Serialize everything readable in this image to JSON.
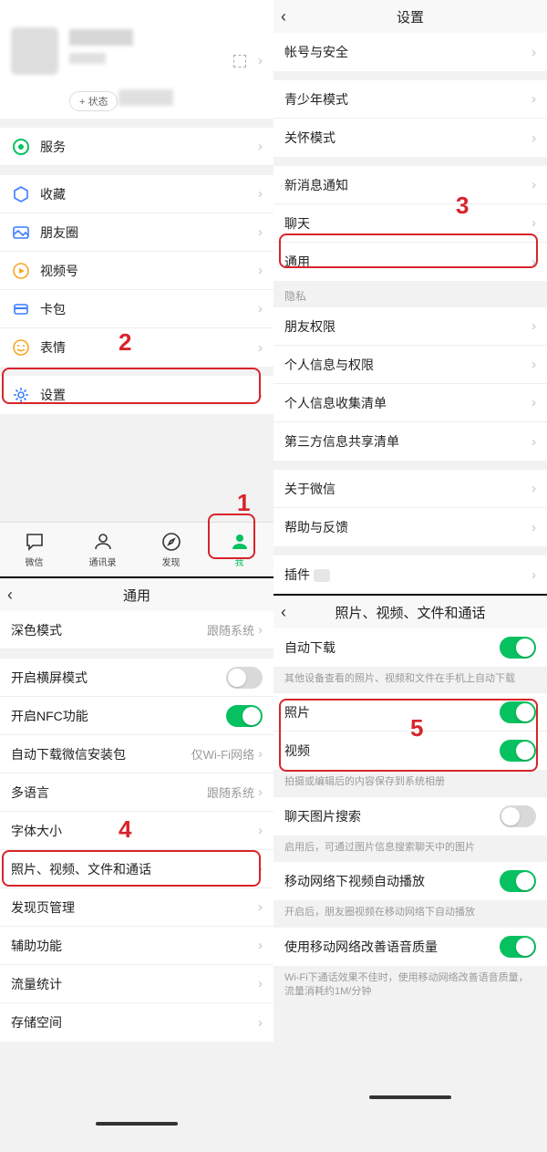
{
  "panel1": {
    "status_pill": "+ 状态",
    "items": {
      "services": "服务",
      "favorites": "收藏",
      "moments": "朋友圈",
      "channels": "视频号",
      "cards": "卡包",
      "stickers": "表情",
      "settings": "设置"
    },
    "tabs": {
      "chat": "微信",
      "contacts": "通讯录",
      "discover": "发现",
      "me": "我"
    }
  },
  "panel2": {
    "title": "设置",
    "items": {
      "account": "帐号与安全",
      "teen": "青少年模式",
      "care": "关怀模式",
      "notify": "新消息通知",
      "chat": "聊天",
      "general": "通用",
      "privacy_hdr": "隐私",
      "friends_perm": "朋友权限",
      "personal_info": "个人信息与权限",
      "info_collect": "个人信息收集清单",
      "thirdparty": "第三方信息共享清单",
      "about": "关于微信",
      "help": "帮助与反馈",
      "plugins": "插件"
    }
  },
  "panel3": {
    "title": "通用",
    "items": {
      "dark": "深色模式",
      "dark_val": "跟随系统",
      "landscape": "开启横屏模式",
      "nfc": "开启NFC功能",
      "autodl": "自动下载微信安装包",
      "autodl_val": "仅Wi-Fi网络",
      "lang": "多语言",
      "lang_val": "跟随系统",
      "font": "字体大小",
      "media": "照片、视频、文件和通话",
      "discover_mgmt": "发现页管理",
      "assist": "辅助功能",
      "traffic": "流量统计",
      "storage": "存储空间"
    }
  },
  "panel4": {
    "title": "照片、视频、文件和通话",
    "items": {
      "autodl": "自动下载",
      "autodl_note": "其他设备查看的照片、视频和文件在手机上自动下载",
      "photo": "照片",
      "video": "视频",
      "save_note": "拍摄或编辑后的内容保存到系统相册",
      "imgsearch": "聊天图片搜索",
      "imgsearch_note": "启用后，可通过图片信息搜索聊天中的图片",
      "mobileplay": "移动网络下视频自动播放",
      "mobileplay_note": "开启后，朋友圈视频在移动网络下自动播放",
      "voicequality": "使用移动网络改善语音质量",
      "voicequality_note": "Wi-Fi下通话效果不佳时，使用移动网络改善语音质量，流量消耗约1M/分钟"
    }
  },
  "annotations": {
    "n1": "1",
    "n2": "2",
    "n3": "3",
    "n4": "4",
    "n5": "5"
  }
}
